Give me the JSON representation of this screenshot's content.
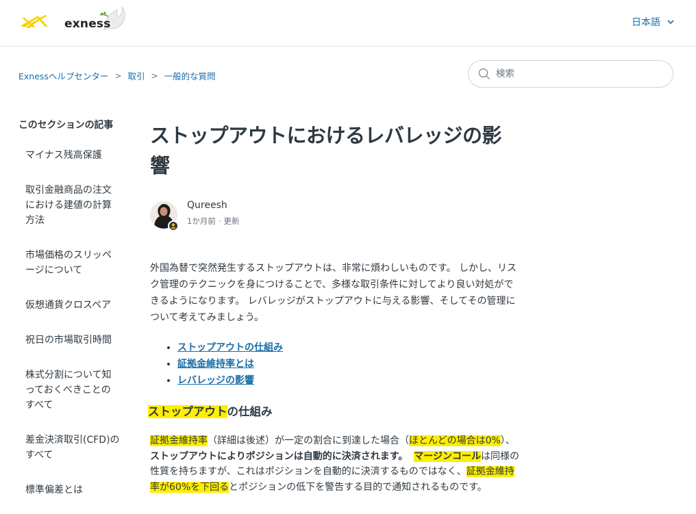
{
  "header": {
    "logo_text": "exness",
    "language": "日本語"
  },
  "breadcrumb": [
    "Exnessヘルプセンター",
    "取引",
    "一般的な質問"
  ],
  "search": {
    "placeholder": "検索"
  },
  "sidebar": {
    "title": "このセクションの記事",
    "items": [
      [
        "マイナス残高保護"
      ],
      [
        "取引金融商品の注文",
        "における建値の計算",
        "方法"
      ],
      [
        "市場価格のスリッペ",
        "ージについて"
      ],
      [
        "仮想通貨クロスペア"
      ],
      [
        "祝日の市場取引時間"
      ],
      [
        "株式分割について知",
        "っておくべきことの",
        "すべて"
      ],
      [
        "差金決済取引(CFD)の",
        "すべて"
      ],
      [
        "標準偏差とは"
      ]
    ]
  },
  "article": {
    "title_lines": [
      "ストップアウトにおけるレバレッジの影",
      "響"
    ],
    "author": "Qureesh",
    "posted": "1か月前",
    "updated": "更新",
    "intro_lines": [
      "外国為替で突然発生するストップアウトは、非常に煩わしいものです。 しかし、リス",
      "ク管理のテクニックを身につけることで、多様な取引条件に対してより良い対処がで",
      "きるようになります。 レバレッジがストップアウトに与える影響、そしてその管理に",
      "ついて考えてみましょう。"
    ],
    "toc": [
      "ストップアウトの仕組み",
      "証拠金維持率とは",
      "レバレッジの影響"
    ],
    "section_heading_hl": "ストップアウト",
    "section_heading_rest": "の仕組み",
    "p2": {
      "l1_hl1": "証拠金維持率",
      "l1_a": "（詳細は後述）が一定の割合に到達した場合（",
      "l1_hl2": "ほとんどの場合は0%",
      "l1_b": "）、",
      "l2_bold": "ストップアウトによりポジションは自動的に決済されます。",
      "l2_hl_bold": "マージンコール",
      "l2_rest": "は同様の",
      "l3_a": "性質を持ちますが、これはポジションを自動的に決済するものではなく、",
      "l3_hl": "証拠金維持",
      "l4_hl": "率が60%を下回る",
      "l4_rest": "とポジションの低下を警告する目的で通知されるものです。"
    },
    "highlight_color": "#ffee00",
    "link_color": "#1a6ea8"
  }
}
